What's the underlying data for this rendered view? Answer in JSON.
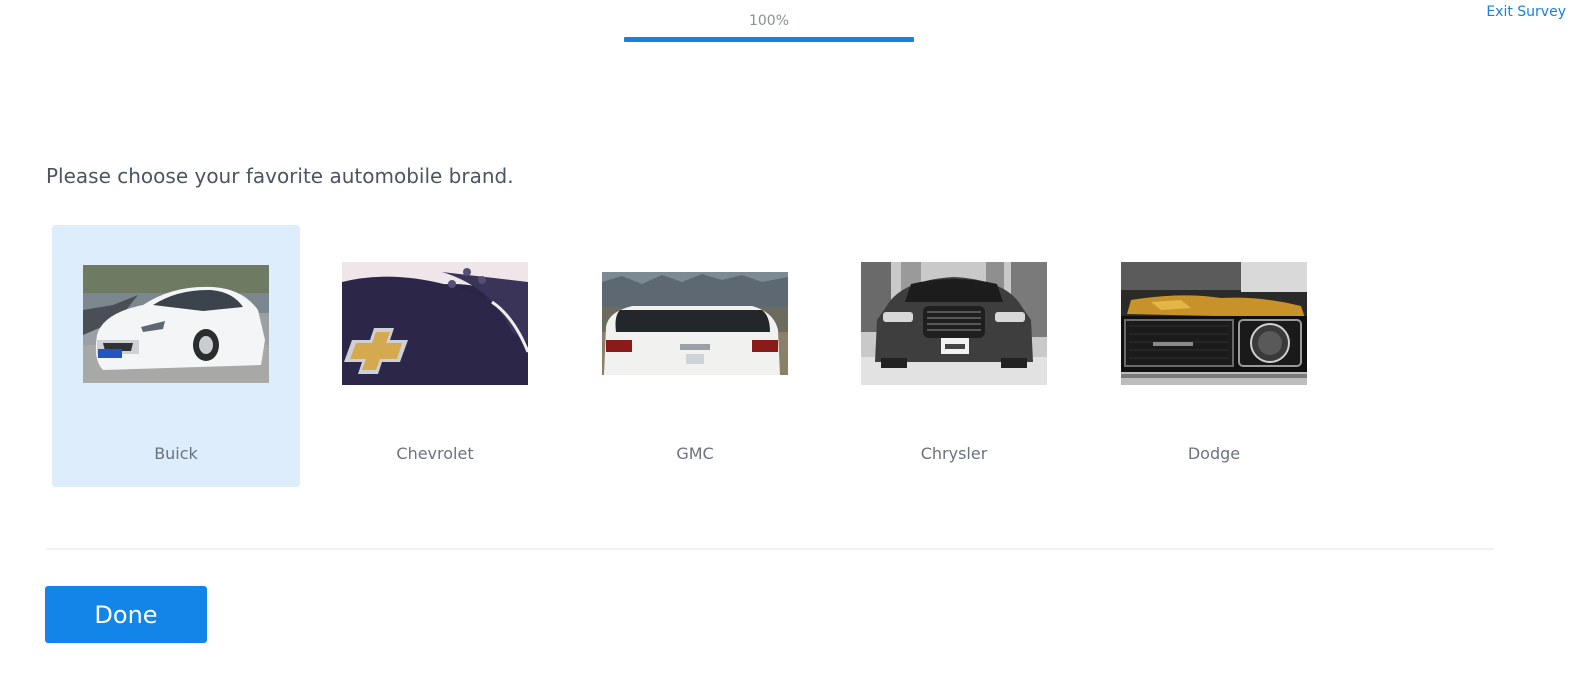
{
  "header": {
    "progress_text": "100%",
    "progress_fraction": 1.0,
    "exit_label": "Exit Survey"
  },
  "question": {
    "text": "Please choose your favorite automobile brand."
  },
  "choices": [
    {
      "label": "Buick",
      "selected": true,
      "image": "white-buick-sedan-photo"
    },
    {
      "label": "Chevrolet",
      "selected": false,
      "image": "chevrolet-steering-wheel-logo-photo"
    },
    {
      "label": "GMC",
      "selected": false,
      "image": "white-gmc-suv-rear-photo"
    },
    {
      "label": "Chrysler",
      "selected": false,
      "image": "chrysler-sedan-front-bw-photo"
    },
    {
      "label": "Dodge",
      "selected": false,
      "image": "vintage-dodge-front-grille-photo"
    }
  ],
  "footer": {
    "done_label": "Done"
  },
  "colors": {
    "accent": "#1a7fe0",
    "button": "#1385e8",
    "selected_bg": "#deedfb",
    "question_text": "#4b5563",
    "label_text": "#6b7280"
  }
}
